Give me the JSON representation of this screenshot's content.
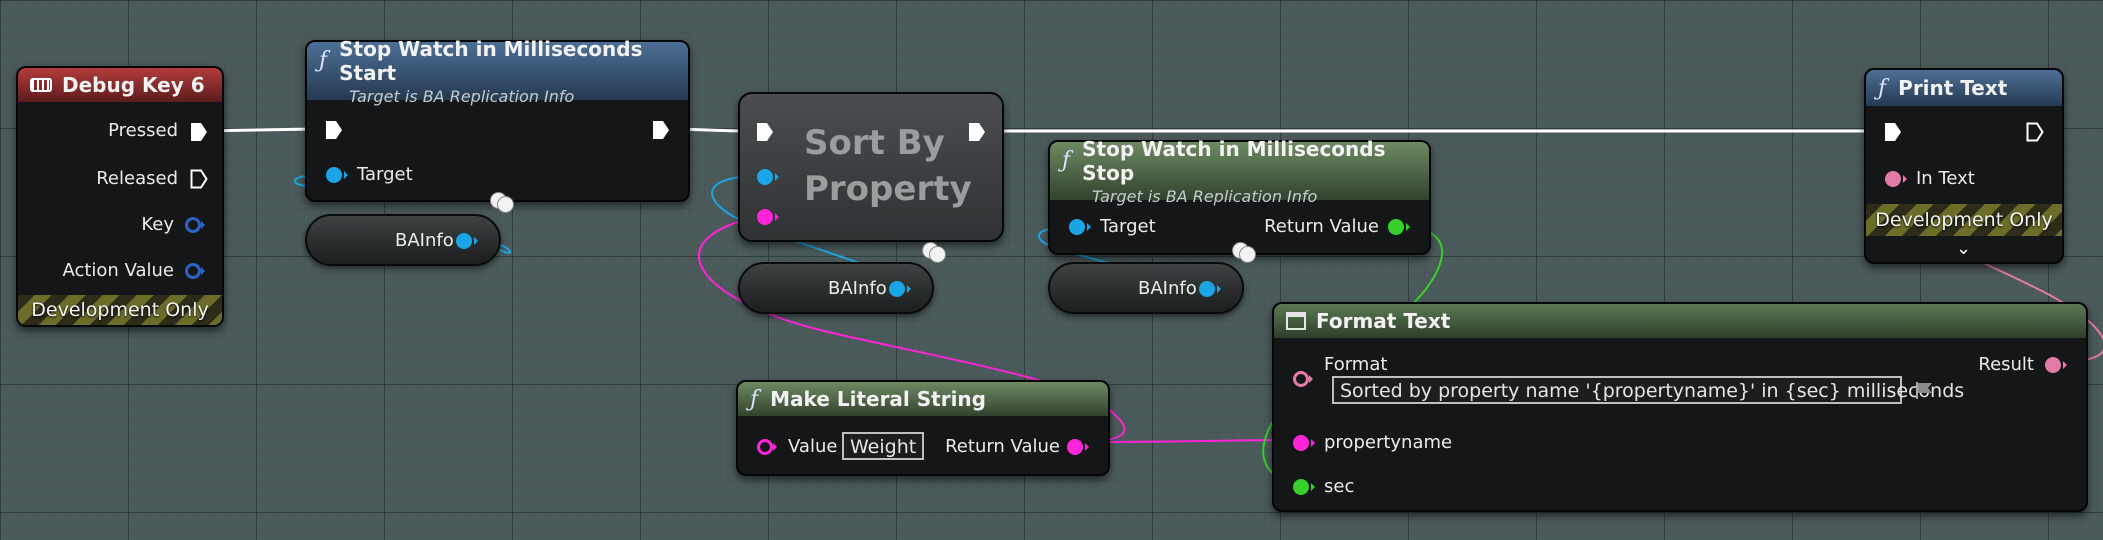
{
  "debug_key_node": {
    "title": "Debug Key 6",
    "pressed": "Pressed",
    "released": "Released",
    "key": "Key",
    "action_value": "Action Value",
    "dev_only": "Development Only"
  },
  "stopwatch_start_node": {
    "title": "Stop Watch in Milliseconds Start",
    "subtitle": "Target is BA Replication Info",
    "target": "Target"
  },
  "sort_node": {
    "title_line1": "Sort By",
    "title_line2": "Property"
  },
  "stopwatch_stop_node": {
    "title": "Stop Watch in Milliseconds Stop",
    "subtitle": "Target is BA Replication Info",
    "target": "Target",
    "return_value": "Return Value"
  },
  "print_text_node": {
    "title": "Print Text",
    "in_text": "In Text",
    "dev_only": "Development Only"
  },
  "format_text_node": {
    "title": "Format Text",
    "format": "Format",
    "format_value": "Sorted by property name '{propertyname}' in  {sec} milliseconds",
    "result": "Result",
    "propertyname": "propertyname",
    "sec": "sec"
  },
  "make_literal_node": {
    "title": "Make Literal String",
    "value": "Value",
    "value_field": "Weight",
    "return_value": "Return Value"
  },
  "variables": {
    "bainfo_1": "BAInfo",
    "bainfo_2": "BAInfo",
    "bainfo_3": "BAInfo"
  },
  "colors": {
    "exec": "#ffffff",
    "object": "#1aa6e6",
    "string": "#ff24d8",
    "int": "#35d12a",
    "text": "#e67aa6",
    "struct": "#2d62c9"
  }
}
